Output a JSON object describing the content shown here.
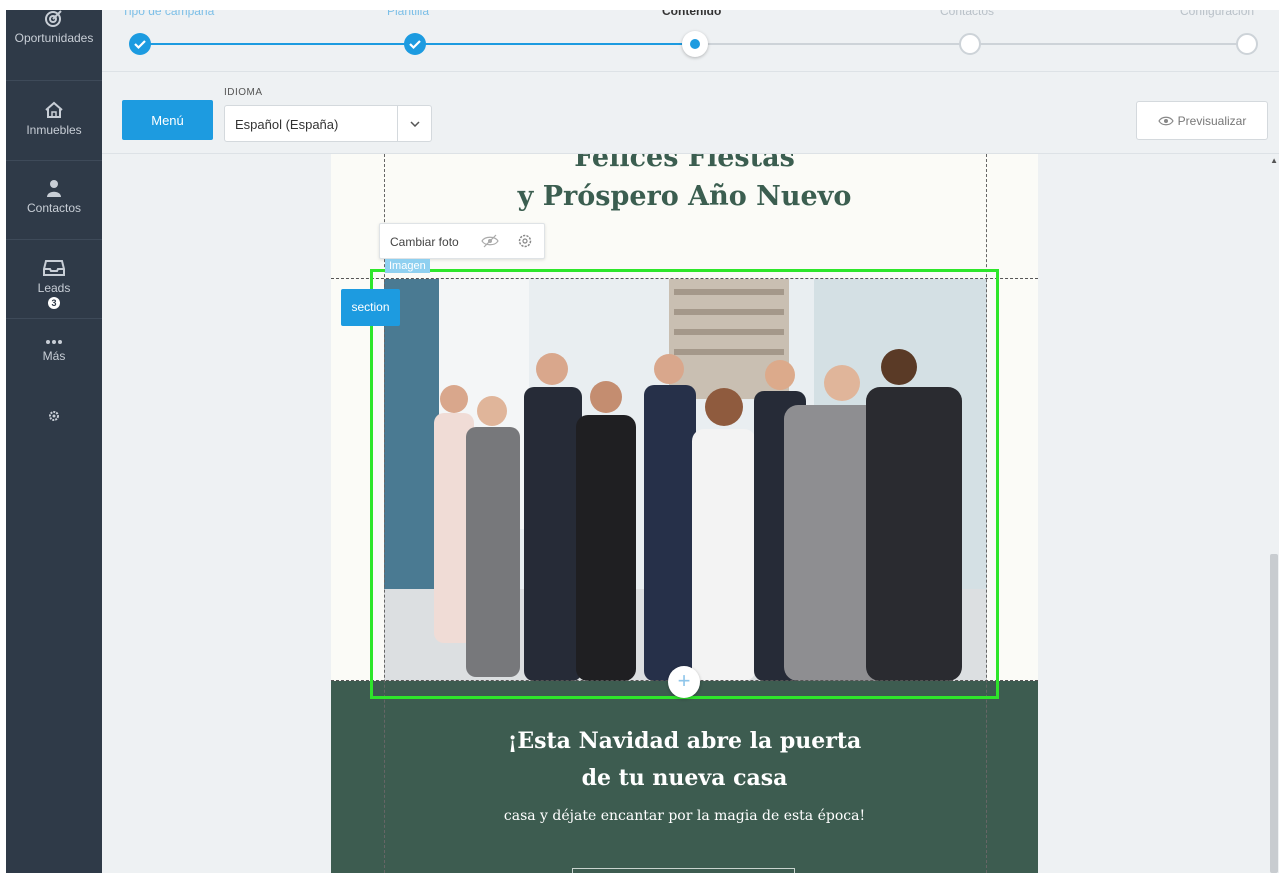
{
  "sidebar": {
    "items": [
      {
        "label": "Oportunidades",
        "icon": "target-icon"
      },
      {
        "label": "Inmuebles",
        "icon": "house-icon"
      },
      {
        "label": "Contactos",
        "icon": "person-icon"
      },
      {
        "label": "Leads",
        "icon": "inbox-icon",
        "badge": "3"
      },
      {
        "label": "Más",
        "icon": "more-icon"
      }
    ],
    "settings_icon": "gear-icon"
  },
  "stepper": {
    "steps": [
      {
        "label": "Tipo de campaña",
        "state": "done"
      },
      {
        "label": "Plantilla",
        "state": "done"
      },
      {
        "label": "Contenido",
        "state": "active"
      },
      {
        "label": "Contactos",
        "state": "todo"
      },
      {
        "label": "Configuración",
        "state": "todo"
      }
    ]
  },
  "toolbar": {
    "menu_label": "Menú",
    "language_label": "IDIOMA",
    "language_value": "Español (España)",
    "preview_label": "Previsualizar"
  },
  "email": {
    "title_line1": "Felices Fiestas",
    "title_line2": "y Próspero Año Nuevo",
    "image_toolbar": {
      "change_photo": "Cambiar foto"
    },
    "image_tag": "Imagen",
    "section_tag": "section",
    "band_title_line1": "¡Esta Navidad abre la puerta",
    "band_title_line2": "de tu nueva casa",
    "band_subtitle": "casa y déjate encantar por la magia de esta época!"
  },
  "colors": {
    "sidebar_bg": "#2f3a48",
    "accent_blue": "#1d9be0",
    "title_green": "#3b5e50",
    "band_green": "#3d5c50",
    "selection_green": "#2ee62a"
  }
}
